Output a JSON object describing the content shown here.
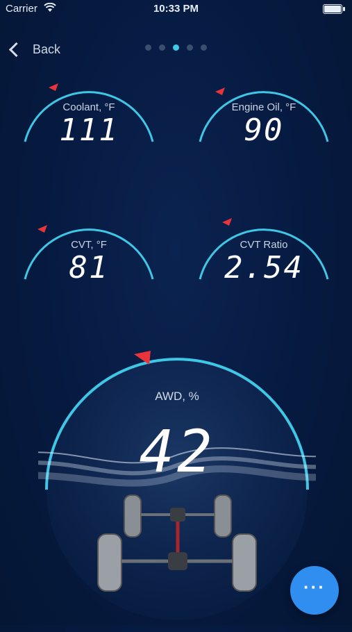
{
  "status": {
    "carrier": "Carrier",
    "time": "10:33 PM"
  },
  "nav": {
    "back_label": "Back",
    "page_count": 5,
    "active_page": 2
  },
  "gauges": [
    {
      "label": "Coolant, °F",
      "value": "111"
    },
    {
      "label": "Engine Oil, °F",
      "value": "90"
    },
    {
      "label": "CVT, °F",
      "value": "81"
    },
    {
      "label": "CVT Ratio",
      "value": "2.54"
    }
  ],
  "awd": {
    "label": "AWD, %",
    "value": "42"
  },
  "colors": {
    "accent": "#3fc7e6",
    "indicator": "#e8343a",
    "fab": "#2f8ef0"
  },
  "fab_icon": "more-dots-icon"
}
